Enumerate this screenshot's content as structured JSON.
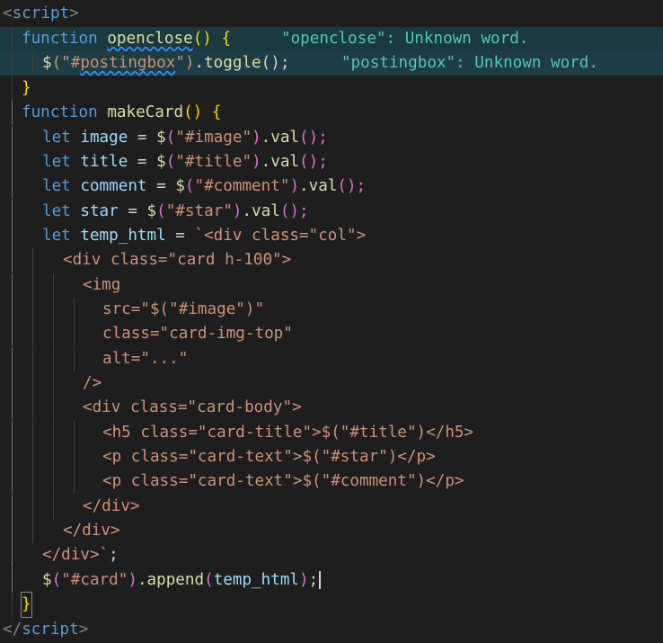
{
  "editor": {
    "language": "javascript",
    "colors": {
      "background": "#1e1e1e",
      "keyword": "#569cd6",
      "function": "#dcdcaa",
      "string": "#ce9178",
      "variable": "#9cdcfe",
      "diagnostic": "#4ec9b0"
    }
  },
  "lines": {
    "l1": {
      "open": "<",
      "name": "script",
      "close": ">"
    },
    "l2": {
      "kw": "function",
      "fn": "openclose",
      "rest": "() {",
      "diagnostic": "\"openclose\": Unknown word."
    },
    "l3": {
      "fn": "$",
      "open": "(\"",
      "sel_hash": "#",
      "sel": "postingbox",
      "close": "\")",
      "call": ".toggle",
      "end": "();",
      "diagnostic": "\"postingbox\": Unknown word."
    },
    "l4": {
      "text": "}"
    },
    "l5": {
      "kw": "function",
      "fn": "makeCard",
      "rest": "() {"
    },
    "l6": {
      "kw": "let",
      "var": "image",
      "eq": " = ",
      "fn": "$",
      "p": "(",
      "str": "\"#image\"",
      "p2": ")",
      "call": ".val",
      "end": "();"
    },
    "l7": {
      "kw": "let",
      "var": "title",
      "eq": " = ",
      "fn": "$",
      "p": "(",
      "str": "\"#title\"",
      "p2": ")",
      "call": ".val",
      "end": "();"
    },
    "l8": {
      "kw": "let",
      "var": "comment",
      "eq": " = ",
      "fn": "$",
      "p": "(",
      "str": "\"#comment\"",
      "p2": ")",
      "call": ".val",
      "end": "();"
    },
    "l9": {
      "kw": "let",
      "var": "star",
      "eq": " = ",
      "fn": "$",
      "p": "(",
      "str": "\"#star\"",
      "p2": ")",
      "call": ".val",
      "end": "();"
    },
    "l10": {
      "kw": "let",
      "var": "temp_html",
      "eq": " = ",
      "str": "`<div class=\"col\">"
    },
    "l11": {
      "str": "<div class=\"card h-100\">"
    },
    "l12": {
      "str": "<img"
    },
    "l13": {
      "str": "src=\"$(\"#image\")\""
    },
    "l14": {
      "str": "class=\"card-img-top\""
    },
    "l15": {
      "str": "alt=\"...\""
    },
    "l16": {
      "str": "/>"
    },
    "l17": {
      "str": "<div class=\"card-body\">"
    },
    "l18": {
      "str": "<h5 class=\"card-title\">$(\"#title\")</h5>"
    },
    "l19": {
      "str": "<p class=\"card-text\">$(\"#star\")</p>"
    },
    "l20": {
      "str": "<p class=\"card-text\">$(\"#comment\")</p>"
    },
    "l21": {
      "str": "</div>"
    },
    "l22": {
      "str": "</div>"
    },
    "l23": {
      "str": "</div>`",
      "end": ";"
    },
    "l24": {
      "fn": "$",
      "p": "(",
      "str": "\"#card\"",
      "p2": ")",
      "call": ".append",
      "p3": "(",
      "var": "temp_html",
      "p4": ")",
      "end": ";"
    },
    "l25": {
      "text": "}"
    },
    "l26": {
      "open": "</",
      "name": "script",
      "close": ">"
    }
  }
}
